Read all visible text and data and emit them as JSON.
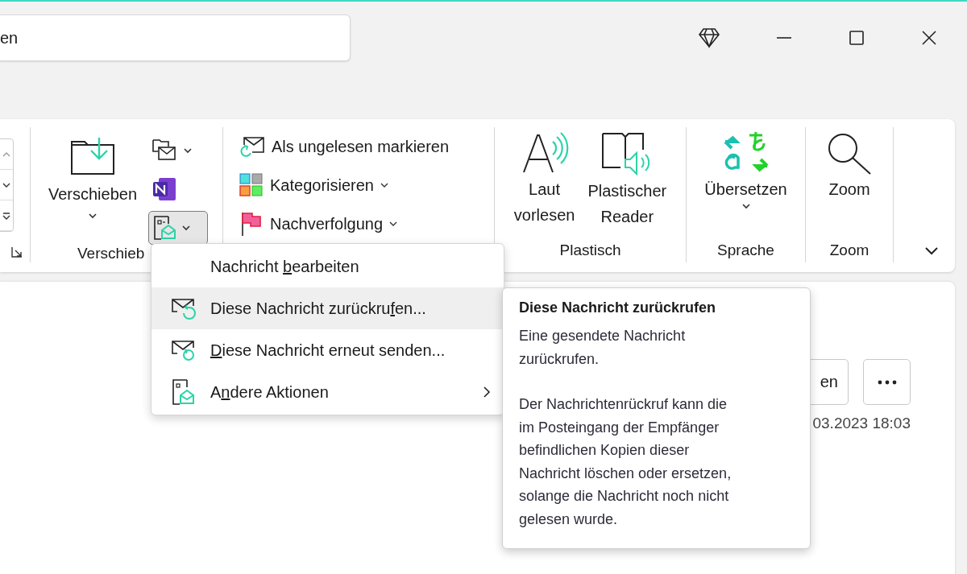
{
  "search": {
    "value": "en"
  },
  "ribbon": {
    "left_group": {
      "launcher": true
    },
    "move_group": {
      "label": "Verschieb",
      "big_button": {
        "label": "Verschieben",
        "dropdown": true
      },
      "small_buttons": [
        {
          "kind": "move-mail",
          "dropdown": true,
          "pressed": false
        },
        {
          "kind": "onenote",
          "dropdown": false,
          "pressed": false
        },
        {
          "kind": "actions",
          "dropdown": true,
          "pressed": true
        }
      ]
    },
    "tags_group": {
      "items": [
        {
          "kind": "unread",
          "label": "Als ungelesen markieren",
          "dropdown": false
        },
        {
          "kind": "categorize",
          "label": "Kategorisieren",
          "dropdown": true
        },
        {
          "kind": "flag",
          "label": "Nachverfolgung",
          "dropdown": true
        }
      ]
    },
    "groups": [
      {
        "label": "Plastisch",
        "buttons": [
          {
            "kind": "read-aloud",
            "lines": [
              "Laut",
              "vorlesen"
            ],
            "dropdown": false
          },
          {
            "kind": "reader",
            "lines": [
              "Plastischer",
              "Reader"
            ],
            "dropdown": false
          }
        ]
      },
      {
        "label": "Sprache",
        "buttons": [
          {
            "kind": "translate",
            "lines": [
              "Übersetzen"
            ],
            "dropdown": true
          }
        ]
      },
      {
        "label": "Zoom",
        "buttons": [
          {
            "kind": "zoom",
            "lines": [
              "Zoom"
            ],
            "dropdown": false
          }
        ]
      }
    ]
  },
  "menu": {
    "items": [
      {
        "kind": "plain",
        "before": "Nachricht ",
        "access_key": "b",
        "after": "earbeiten",
        "selected": false,
        "submenu": false
      },
      {
        "kind": "recall",
        "before": "Diese Nachricht zurückru",
        "access_key": "f",
        "after": "en...",
        "selected": true,
        "submenu": false
      },
      {
        "kind": "resend",
        "access_key": "D",
        "after": "iese Nachricht erneut senden...",
        "selected": false,
        "submenu": false
      },
      {
        "kind": "actions",
        "before": "A",
        "access_key": "n",
        "after": "dere Aktionen",
        "selected": false,
        "submenu": true
      }
    ]
  },
  "tooltip": {
    "title": "Diese Nachricht zurückrufen",
    "paragraphs": [
      "Eine gesendete Nachricht zurückrufen.",
      "Der Nachrichtenrückruf kann die im Posteingang der Empfänger befindlichen Kopien dieser Nachricht löschen oder ersetzen, solange die Nachricht noch nicht gelesen wurde."
    ]
  },
  "message": {
    "button_text": "en",
    "date": "03.2023 18:03"
  }
}
